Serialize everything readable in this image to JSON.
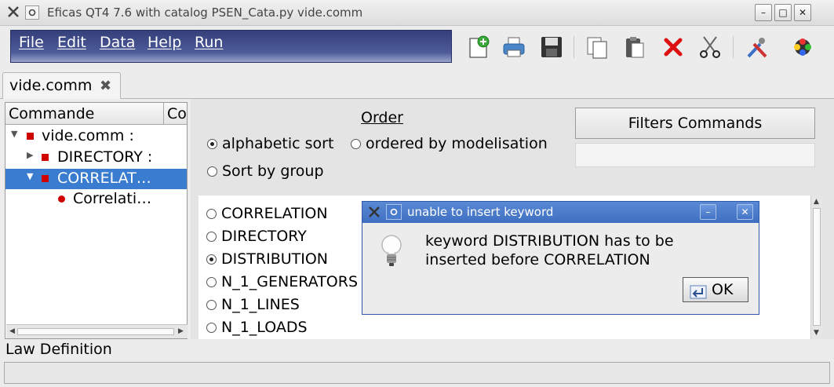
{
  "window": {
    "title": "Eficas QT4 7.6 with catalog  PSEN_Cata.py vide.comm",
    "minimize": "–",
    "maximize": "□",
    "close": "✕"
  },
  "menu": {
    "file": "File",
    "edit": "Edit",
    "data": "Data",
    "help": "Help",
    "run": "Run"
  },
  "toolbar": {
    "icons": [
      "new-file",
      "print",
      "save",
      "copy",
      "paste",
      "delete",
      "cut",
      "settings",
      "palette"
    ]
  },
  "tab": {
    "label": "vide.comm",
    "close": "✖"
  },
  "tree": {
    "headers": [
      "Commande",
      "Concept"
    ],
    "rows": [
      {
        "label": "vide.comm :",
        "expanded": true
      },
      {
        "label": "DIRECTORY :",
        "expanded": false
      },
      {
        "label": "CORRELAT…",
        "expanded": true,
        "selected": true
      },
      {
        "label": "Correlati…"
      }
    ]
  },
  "order": {
    "title": "Order",
    "options": [
      "alphabetic sort",
      "ordered by modelisation",
      "Sort by group"
    ],
    "selected": "alphabetic sort"
  },
  "filters": {
    "button": "Filters Commands",
    "value": ""
  },
  "commands": {
    "items": [
      "CORRELATION",
      "DIRECTORY",
      "DISTRIBUTION",
      "N_1_GENERATORS",
      "N_1_LINES",
      "N_1_LOADS"
    ],
    "selected": "DISTRIBUTION"
  },
  "dialog": {
    "title": "unable to insert keyword",
    "line1": "keyword DISTRIBUTION has to be",
    "line2": "inserted before CORRELATION",
    "ok": "OK",
    "minimize": "–",
    "close": "✕"
  },
  "status": {
    "label": "Law Definition",
    "message": ""
  },
  "colors": {
    "menu_bg": "#3c4884",
    "selection": "#3a7dd0",
    "dialog_title": "#4a7acb",
    "marker": "#d10000"
  }
}
